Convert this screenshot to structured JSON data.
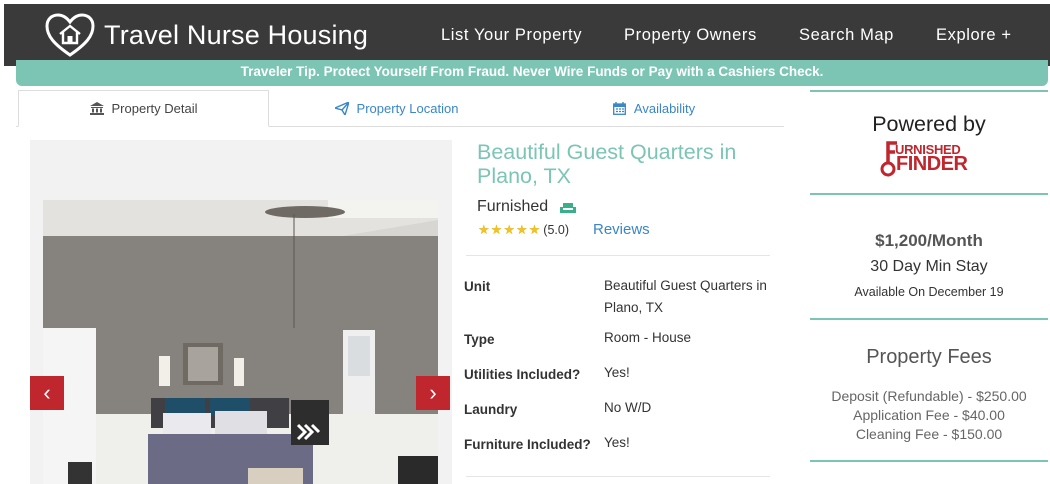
{
  "header": {
    "logo_text": "Travel Nurse Housing",
    "nav": [
      "List Your Property",
      "Property Owners",
      "Search Map",
      "Explore +"
    ]
  },
  "tip": "Traveler Tip. Protect Yourself From Fraud. Never Wire Funds or Pay with a Cashiers Check.",
  "tabs": [
    "Property Detail",
    "Property Location",
    "Availability"
  ],
  "property": {
    "title": "Beautiful Guest Quarters in Plano, TX",
    "furnished": "Furnished",
    "rating_text": "(5.0)",
    "rating": 5,
    "reviews_label": "Reviews",
    "details": [
      {
        "label": "Unit",
        "value": "Beautiful Guest Quarters in Plano, TX"
      },
      {
        "label": "Type",
        "value": "Room - House"
      },
      {
        "label": "Utilities Included?",
        "value": "Yes!"
      },
      {
        "label": "Laundry",
        "value": "No W/D"
      },
      {
        "label": "Furniture Included?",
        "value": "Yes!"
      }
    ]
  },
  "sidebar": {
    "powered_by": "Powered by",
    "partner_logo": "URNISHED FINDER",
    "partner_logo_lines": [
      "URNISHED",
      "FINDER"
    ],
    "price": "$1,200/Month",
    "min_stay": "30 Day Min Stay",
    "available": "Available On December 19",
    "fees_title": "Property Fees",
    "fees": [
      "Deposit (Refundable) - $250.00",
      "Application Fee - $40.00",
      "Cleaning Fee - $150.00"
    ]
  },
  "colors": {
    "accent": "#7cc5b5",
    "header_bg": "#3a3a3a",
    "link": "#3a86c7",
    "arrow_bg": "#c0262d",
    "brand_red": "#c0262d"
  },
  "icons": [
    "house-heart-icon",
    "bank-icon",
    "paper-plane-icon",
    "calendar-icon",
    "sofa-icon",
    "star-icon",
    "chevron-left-icon",
    "chevron-right-icon",
    "key-icon"
  ]
}
